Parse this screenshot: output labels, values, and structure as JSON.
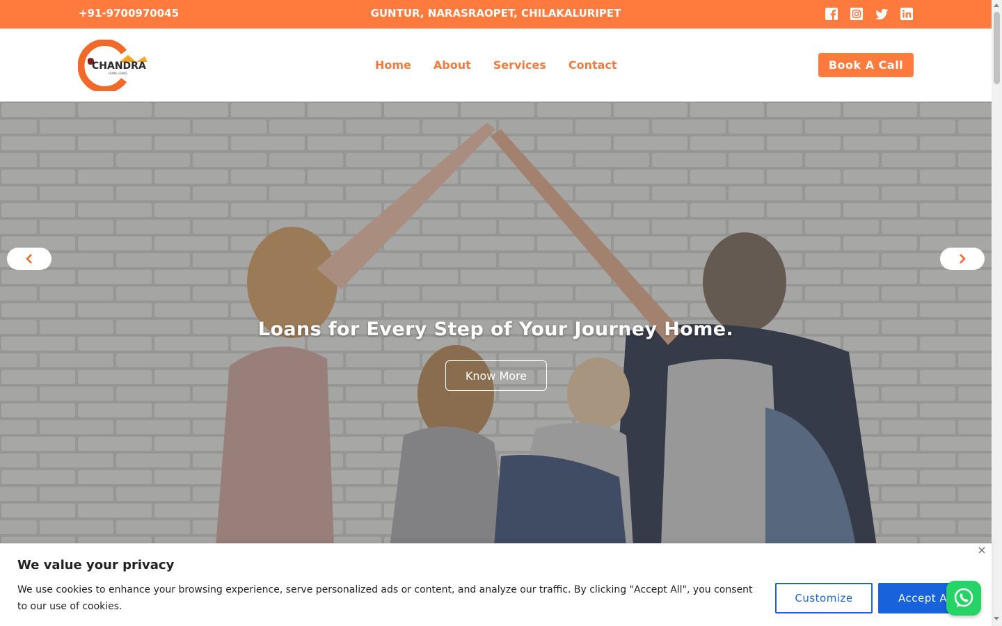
{
  "topbar": {
    "phone": "+91-9700970045",
    "locations": "GUNTUR, NARASRAOPET, CHILAKALURIPET",
    "socials": [
      "facebook-icon",
      "instagram-icon",
      "twitter-icon",
      "linkedin-icon"
    ]
  },
  "header": {
    "logo_text": "CHANDRA",
    "logo_subtext": "HOME LOANS",
    "nav": [
      "Home",
      "About",
      "Services",
      "Contact"
    ],
    "cta": "Book A Call"
  },
  "hero": {
    "title": "Loans for Every Step of Your Journey Home.",
    "button": "Know More",
    "prev_icon": "chevron-left-icon",
    "next_icon": "chevron-right-icon"
  },
  "cookie": {
    "title": "We value your privacy",
    "text": "We use cookies to enhance your browsing experience, serve personalized ads or content, and analyze our traffic. By clicking \"Accept All\", you consent to our use of cookies.",
    "customize": "Customize",
    "accept": "Accept All",
    "close_icon": "close-icon"
  },
  "colors": {
    "brand_orange": "#ff7a3d",
    "cookie_blue": "#1863dc",
    "whatsapp_green": "#25d366"
  }
}
